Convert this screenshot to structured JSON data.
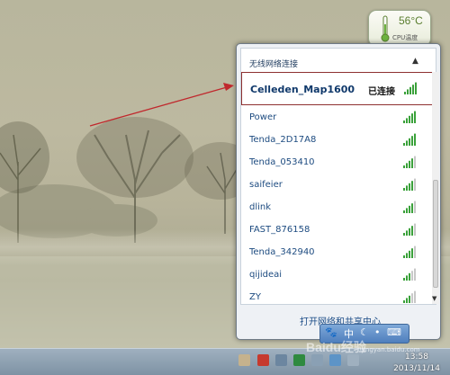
{
  "gadget": {
    "temperature": "56°C",
    "label": "CPU温度"
  },
  "flyout": {
    "section_header": "无线网络连接",
    "collapse_icon": "caret-up-icon",
    "networks": [
      {
        "name": "Celleden_Map1600",
        "status": "已连接",
        "signal": 5,
        "connected": true
      },
      {
        "name": "Power",
        "status": "",
        "signal": 5,
        "connected": false
      },
      {
        "name": "Tenda_2D17A8",
        "status": "",
        "signal": 5,
        "connected": false
      },
      {
        "name": "Tenda_053410",
        "status": "",
        "signal": 4,
        "connected": false
      },
      {
        "name": "saifeier",
        "status": "",
        "signal": 4,
        "connected": false
      },
      {
        "name": "dlink",
        "status": "",
        "signal": 4,
        "connected": false
      },
      {
        "name": "FAST_876158",
        "status": "",
        "signal": 4,
        "connected": false
      },
      {
        "name": "Tenda_342940",
        "status": "",
        "signal": 4,
        "connected": false
      },
      {
        "name": "qijideai",
        "status": "",
        "signal": 3,
        "connected": false
      },
      {
        "name": "ZY",
        "status": "",
        "signal": 3,
        "connected": false
      }
    ],
    "footer_link": "打开网络和共享中心"
  },
  "ime": {
    "mode": "中"
  },
  "taskbar": {
    "time": "13:58",
    "date": "2013/11/14"
  },
  "watermark": {
    "text": "Baidu经验",
    "url": "jingyan.baidu.com"
  },
  "colors": {
    "accent_red": "#c0282d",
    "signal_green": "#3aa13a",
    "link_blue": "#1d4b80"
  }
}
